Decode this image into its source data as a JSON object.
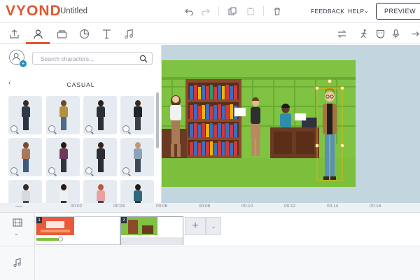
{
  "header": {
    "logo": "VYOND",
    "document_title": "Untitled",
    "feedback": "FEEDBACK",
    "help": "HELP",
    "preview": "PREVIEW",
    "icons": [
      "undo-icon",
      "redo-icon",
      "copy-icon",
      "paste-icon",
      "trash-icon",
      "exit-icon"
    ]
  },
  "toolbar": {
    "tabs": [
      "upload-icon",
      "character-icon",
      "props-icon",
      "chart-icon",
      "text-icon",
      "audio-icon"
    ],
    "active_tab": "character-icon",
    "right_tools": [
      "swap-icon",
      "action-icon",
      "expression-icon",
      "microphone-icon"
    ]
  },
  "panel": {
    "search_placeholder": "Search characters...",
    "category": "CASUAL",
    "character_count_visible": 12
  },
  "timeline": {
    "ticks": [
      "00:02",
      "00:04",
      "00:06",
      "00:08",
      "00:10",
      "00:12",
      "00:14",
      "00:16"
    ],
    "scenes": [
      {
        "number": "1"
      },
      {
        "number": "2"
      }
    ],
    "add_label": "+"
  },
  "colors": {
    "brand": "#e2572e",
    "scene_green": "#7fc241",
    "stage_bg": "#c3d6e0",
    "bookshelf": "#8b4a2b"
  }
}
